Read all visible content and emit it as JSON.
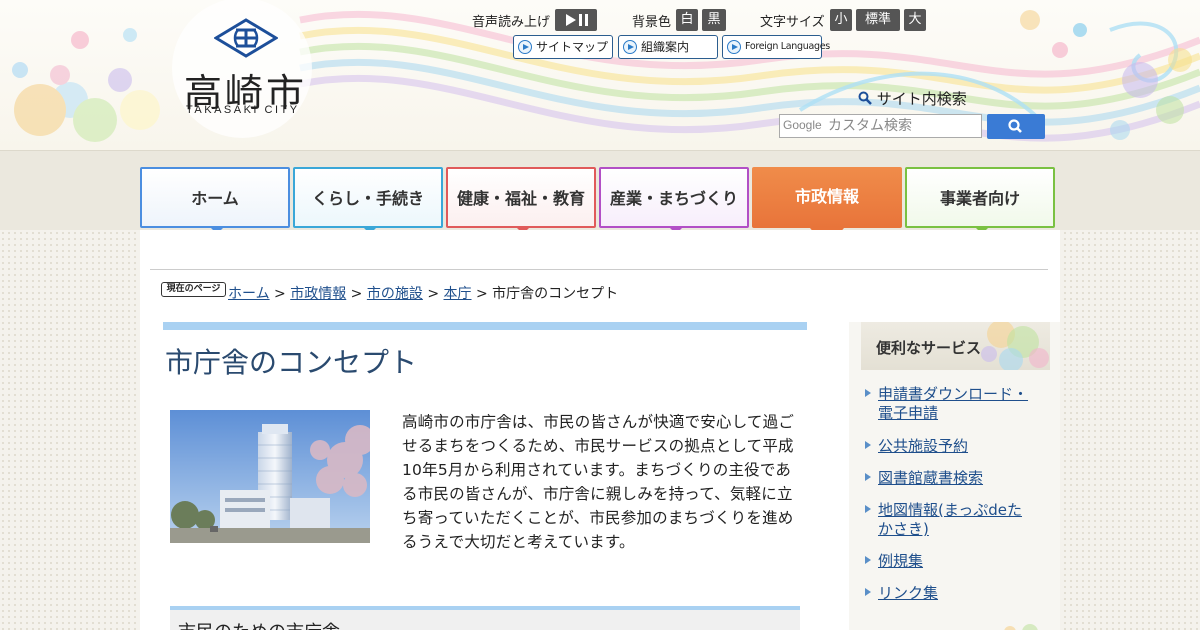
{
  "header": {
    "logo_text": "高崎市",
    "logo_sub": "TAKASAKI CITY",
    "voice_label": "音声読み上げ",
    "bg_color_label": "背景色",
    "bg_white": "白",
    "bg_black": "黒",
    "font_size_label": "文字サイズ",
    "font_small": "小",
    "font_standard": "標準",
    "font_large": "大",
    "links": {
      "sitemap": "サイトマップ",
      "org": "組織案内",
      "foreign": "Foreign Languages"
    },
    "search_label": "サイト内検索",
    "search_placeholder": "カスタム検索",
    "google_label": "Google"
  },
  "nav": {
    "tabs": [
      {
        "label": "ホーム",
        "color": "#4b8ee0"
      },
      {
        "label": "くらし・手続き",
        "color": "#3aa7d8"
      },
      {
        "label": "健康・福祉・教育",
        "color": "#e05a5a"
      },
      {
        "label": "産業・まちづくり",
        "color": "#b24fc6"
      },
      {
        "label": "市政情報",
        "color": "#e8743a"
      },
      {
        "label": "事業者向け",
        "color": "#7ac142"
      }
    ]
  },
  "breadcrumb": {
    "here_label": "現在のページ",
    "items": [
      "ホーム",
      "市政情報",
      "市の施設",
      "本庁"
    ],
    "current": "市庁舎のコンセプト"
  },
  "main": {
    "title": "市庁舎のコンセプト",
    "intro": "高崎市の市庁舎は、市民の皆さんが快適で安心して過ごせるまちをつくるため、市民サービスの拠点として平成10年5月から利用されています。まちづくりの主役である市民の皆さんが、市庁舎に親しみを持って、気軽に立ち寄っていただくことが、市民参加のまちづくりを進めるうえで大切だと考えています。",
    "section_heading": "市民のための市庁舎"
  },
  "side": {
    "heading": "便利なサービス",
    "links": [
      {
        "line1": "申請書ダウンロード・",
        "line2": "電子申請"
      },
      {
        "line1": "公共施設予約",
        "line2": ""
      },
      {
        "line1": "図書館蔵書検索",
        "line2": ""
      },
      {
        "line1": "地図情報(まっぷdeた",
        "line2": "かさき)"
      },
      {
        "line1": "例規集",
        "line2": ""
      },
      {
        "line1": "リンク集",
        "line2": ""
      }
    ]
  },
  "colors": {
    "accent_active": "#e8743a",
    "link": "#1f4f8c",
    "title_bar": "#a9d1f2",
    "search_button": "#3a7bd5"
  }
}
